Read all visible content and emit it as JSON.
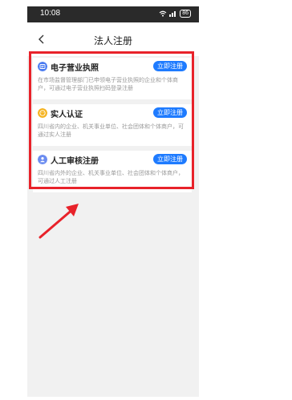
{
  "status_bar": {
    "time": "10:08",
    "battery": "86"
  },
  "header": {
    "title": "法人注册"
  },
  "cards": [
    {
      "title": "电子营业执照",
      "button": "立即注册",
      "description": "在市场监督管理部门已申领电子营业执照的企业和个体商户，可通过电子营业执照扫码登录注册",
      "icon": "license-icon",
      "icon_color": "#4a7bf0"
    },
    {
      "title": "实人认证",
      "button": "立即注册",
      "description": "四川省内的企业、机关事业单位、社会团体和个体商户，可通过实人注册",
      "icon": "face-icon",
      "icon_color": "#f5b320"
    },
    {
      "title": "人工审核注册",
      "button": "立即注册",
      "description": "四川省内外的企业、机关事业单位、社会团体和个体商户，可通过人工注册",
      "icon": "review-icon",
      "icon_color": "#6b8cf0"
    }
  ],
  "annotation": {
    "highlight_color": "#e8222a"
  }
}
